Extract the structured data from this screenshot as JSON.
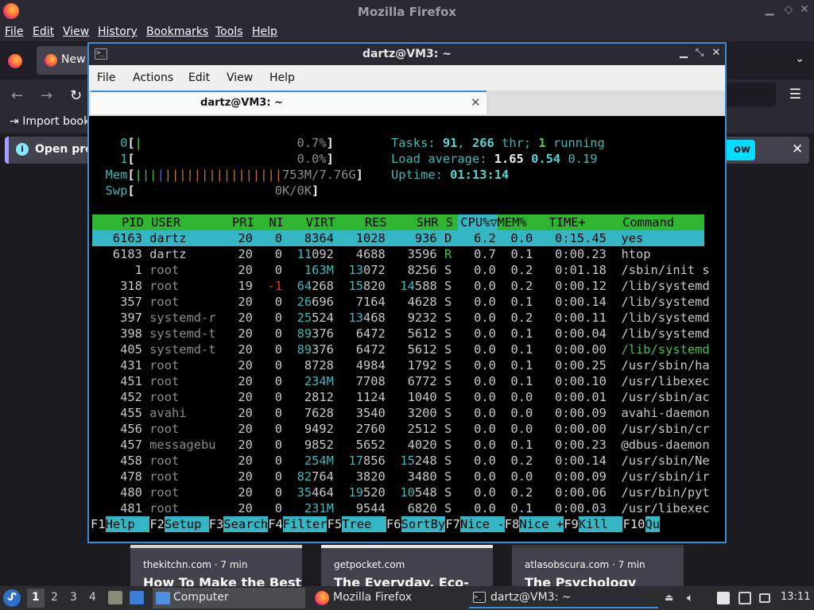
{
  "firefox": {
    "window_title": "Mozilla Firefox",
    "menu": [
      "File",
      "Edit",
      "View",
      "History",
      "Bookmarks",
      "Tools",
      "Help"
    ],
    "tab_label": "New",
    "import_label": "Import book",
    "notification_text": "Open pre",
    "notification_button": "ow",
    "pocket_cards": [
      {
        "source": "thekitchn.com · 7 min",
        "title": "How To Make the Best"
      },
      {
        "source": "getpocket.com",
        "title": "The Everyday, Eco-"
      },
      {
        "source": "atlasobscura.com · 7 min",
        "title": "The Psychology"
      }
    ]
  },
  "terminal": {
    "window_title": "dartz@VM3: ~",
    "menu": [
      "File",
      "Actions",
      "Edit",
      "View",
      "Help"
    ],
    "tab_label": "dartz@VM3: ~",
    "tab_close": "✕"
  },
  "htop": {
    "meters": {
      "cpu0_label": "0",
      "cpu0_value": "0.7%",
      "cpu1_label": "1",
      "cpu1_value": "0.0%",
      "mem_label": "Mem",
      "mem_value": "753M/7.76G",
      "swp_label": "Swp",
      "swp_value": "0K/0K"
    },
    "tasks": {
      "label": "Tasks: ",
      "tasks": "91",
      "thr": "266",
      "thr_label": " thr; ",
      "running": "1",
      "running_label": " running"
    },
    "load": {
      "label": "Load average: ",
      "l1": "1.65",
      "l5": "0.54",
      "l15": "0.19"
    },
    "uptime": {
      "label": "Uptime: ",
      "value": "01:13:14"
    },
    "columns": [
      "PID",
      "USER",
      "PRI",
      "NI",
      "VIRT",
      "RES",
      "SHR",
      "S",
      "CPU%▽",
      "MEM%",
      "TIME+",
      "Command"
    ],
    "processes": [
      {
        "pid": "6163",
        "user": "dartz",
        "pri": "20",
        "ni": "0",
        "virt": "8364",
        "res": "1028",
        "shr": "936",
        "s": "D",
        "cpu": "6.2",
        "mem": "0.0",
        "time": "0:15.45",
        "cmd": "yes"
      },
      {
        "pid": "6183",
        "user": "dartz",
        "pri": "20",
        "ni": "0",
        "virt": "11092",
        "res": "4688",
        "shr": "3596",
        "s": "R",
        "cpu": "0.7",
        "mem": "0.1",
        "time": "0:00.23",
        "cmd": "htop"
      },
      {
        "pid": "1",
        "user": "root",
        "pri": "20",
        "ni": "0",
        "virt": "163M",
        "res": "13072",
        "shr": "8256",
        "s": "S",
        "cpu": "0.0",
        "mem": "0.2",
        "time": "0:01.18",
        "cmd": "/sbin/init s"
      },
      {
        "pid": "318",
        "user": "root",
        "pri": "19",
        "ni": "-1",
        "virt": "64268",
        "res": "15820",
        "shr": "14588",
        "s": "S",
        "cpu": "0.0",
        "mem": "0.2",
        "time": "0:00.12",
        "cmd": "/lib/systemd"
      },
      {
        "pid": "357",
        "user": "root",
        "pri": "20",
        "ni": "0",
        "virt": "26696",
        "res": "7164",
        "shr": "4628",
        "s": "S",
        "cpu": "0.0",
        "mem": "0.1",
        "time": "0:00.14",
        "cmd": "/lib/systemd"
      },
      {
        "pid": "397",
        "user": "systemd-r",
        "pri": "20",
        "ni": "0",
        "virt": "25524",
        "res": "13468",
        "shr": "9232",
        "s": "S",
        "cpu": "0.0",
        "mem": "0.2",
        "time": "0:00.11",
        "cmd": "/lib/systemd"
      },
      {
        "pid": "398",
        "user": "systemd-t",
        "pri": "20",
        "ni": "0",
        "virt": "89376",
        "res": "6472",
        "shr": "5612",
        "s": "S",
        "cpu": "0.0",
        "mem": "0.1",
        "time": "0:00.04",
        "cmd": "/lib/systemd"
      },
      {
        "pid": "405",
        "user": "systemd-t",
        "pri": "20",
        "ni": "0",
        "virt": "89376",
        "res": "6472",
        "shr": "5612",
        "s": "S",
        "cpu": "0.0",
        "mem": "0.1",
        "time": "0:00.00",
        "cmd": "/lib/systemd"
      },
      {
        "pid": "431",
        "user": "root",
        "pri": "20",
        "ni": "0",
        "virt": "8728",
        "res": "4984",
        "shr": "1792",
        "s": "S",
        "cpu": "0.0",
        "mem": "0.1",
        "time": "0:00.25",
        "cmd": "/usr/sbin/ha"
      },
      {
        "pid": "451",
        "user": "root",
        "pri": "20",
        "ni": "0",
        "virt": "234M",
        "res": "7708",
        "shr": "6772",
        "s": "S",
        "cpu": "0.0",
        "mem": "0.1",
        "time": "0:00.10",
        "cmd": "/usr/libexec"
      },
      {
        "pid": "452",
        "user": "root",
        "pri": "20",
        "ni": "0",
        "virt": "2812",
        "res": "1124",
        "shr": "1040",
        "s": "S",
        "cpu": "0.0",
        "mem": "0.0",
        "time": "0:00.01",
        "cmd": "/usr/sbin/ac"
      },
      {
        "pid": "455",
        "user": "avahi",
        "pri": "20",
        "ni": "0",
        "virt": "7628",
        "res": "3540",
        "shr": "3200",
        "s": "S",
        "cpu": "0.0",
        "mem": "0.0",
        "time": "0:00.09",
        "cmd": "avahi-daemon"
      },
      {
        "pid": "456",
        "user": "root",
        "pri": "20",
        "ni": "0",
        "virt": "9492",
        "res": "2760",
        "shr": "2512",
        "s": "S",
        "cpu": "0.0",
        "mem": "0.0",
        "time": "0:00.00",
        "cmd": "/usr/sbin/cr"
      },
      {
        "pid": "457",
        "user": "messagebu",
        "pri": "20",
        "ni": "0",
        "virt": "9852",
        "res": "5652",
        "shr": "4020",
        "s": "S",
        "cpu": "0.0",
        "mem": "0.1",
        "time": "0:00.23",
        "cmd": "@dbus-daemon"
      },
      {
        "pid": "458",
        "user": "root",
        "pri": "20",
        "ni": "0",
        "virt": "254M",
        "res": "17856",
        "shr": "15248",
        "s": "S",
        "cpu": "0.0",
        "mem": "0.2",
        "time": "0:00.14",
        "cmd": "/usr/sbin/Ne"
      },
      {
        "pid": "478",
        "user": "root",
        "pri": "20",
        "ni": "0",
        "virt": "82764",
        "res": "3820",
        "shr": "3480",
        "s": "S",
        "cpu": "0.0",
        "mem": "0.0",
        "time": "0:00.09",
        "cmd": "/usr/sbin/ir"
      },
      {
        "pid": "480",
        "user": "root",
        "pri": "20",
        "ni": "0",
        "virt": "35464",
        "res": "19520",
        "shr": "10548",
        "s": "S",
        "cpu": "0.0",
        "mem": "0.2",
        "time": "0:00.06",
        "cmd": "/usr/bin/pyt"
      },
      {
        "pid": "481",
        "user": "root",
        "pri": "20",
        "ni": "0",
        "virt": "231M",
        "res": "9544",
        "shr": "6820",
        "s": "S",
        "cpu": "0.0",
        "mem": "0.1",
        "time": "0:00.03",
        "cmd": "/usr/libexec"
      }
    ],
    "fkeys": [
      {
        "key": "F1",
        "label": "Help  "
      },
      {
        "key": "F2",
        "label": "Setup "
      },
      {
        "key": "F3",
        "label": "Search"
      },
      {
        "key": "F4",
        "label": "Filter"
      },
      {
        "key": "F5",
        "label": "Tree  "
      },
      {
        "key": "F6",
        "label": "SortBy"
      },
      {
        "key": "F7",
        "label": "Nice -"
      },
      {
        "key": "F8",
        "label": "Nice +"
      },
      {
        "key": "F9",
        "label": "Kill  "
      },
      {
        "key": "F10",
        "label": "Qu"
      }
    ]
  },
  "taskbar": {
    "workspaces": [
      "1",
      "2",
      "3",
      "4"
    ],
    "tasks": [
      {
        "label": "Computer",
        "icon": "folder-icon"
      },
      {
        "label": "Mozilla Firefox",
        "icon": "firefox-icon"
      },
      {
        "label": "dartz@VM3: ~",
        "icon": "terminal-icon"
      }
    ],
    "clock": "13:11"
  },
  "colors": {
    "htop_header_bg": "#2fb52f",
    "htop_selected_bg": "#34b6c4",
    "window_border": "#3b8fd9",
    "firefox_accent": "#00ddff"
  }
}
